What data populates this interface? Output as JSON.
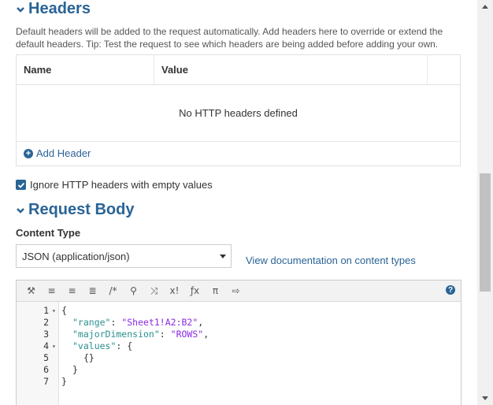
{
  "colors": {
    "accent": "#2a6496",
    "border": "#dde2e6",
    "toolbar_bg": "#f2f2f2"
  },
  "headers_section": {
    "title": "Headers",
    "description": "Default headers will be added to the request automatically. Add headers here to override or extend the default headers. Tip: Test the request to see which headers are being added before adding your own.",
    "table": {
      "col_name": "Name",
      "col_value": "Value",
      "empty_message": "No HTTP headers defined"
    },
    "add_header_label": "Add Header"
  },
  "ignore_empty": {
    "label": "Ignore HTTP headers with empty values",
    "checked": true
  },
  "body_section": {
    "title": "Request Body",
    "content_type_label": "Content Type",
    "content_type_value": "JSON (application/json)",
    "doc_link": "View documentation on content types"
  },
  "editor": {
    "toolbar_icons": [
      "magic-wand-icon",
      "indent-icon",
      "outdent-icon",
      "list-icon",
      "comment-icon",
      "search-icon",
      "shuffle-icon",
      "clear-icon",
      "function-icon",
      "pi-icon",
      "export-icon"
    ],
    "toolbar_glyphs": [
      "⚒",
      "≡",
      "≡",
      "≣",
      "/*",
      "⚲",
      "⤨",
      "x!",
      "ƒx",
      "π",
      "⇨"
    ],
    "help_icon": "?",
    "lines": [
      {
        "num": "1",
        "fold": true,
        "indent": 0,
        "text": "{"
      },
      {
        "num": "2",
        "fold": false,
        "indent": 1,
        "key": "\"range\"",
        "sep": ": ",
        "val": "\"Sheet1!A2:B2\"",
        "tail": ","
      },
      {
        "num": "3",
        "fold": false,
        "indent": 1,
        "key": "\"majorDimension\"",
        "sep": ": ",
        "val": "\"ROWS\"",
        "tail": ","
      },
      {
        "num": "4",
        "fold": true,
        "indent": 1,
        "key": "\"values\"",
        "sep": ": ",
        "val": "",
        "tail": "{"
      },
      {
        "num": "5",
        "fold": false,
        "indent": 2,
        "text": "{}"
      },
      {
        "num": "6",
        "fold": false,
        "indent": 1,
        "text": "}"
      },
      {
        "num": "7",
        "fold": false,
        "indent": 0,
        "text": "}"
      }
    ]
  }
}
